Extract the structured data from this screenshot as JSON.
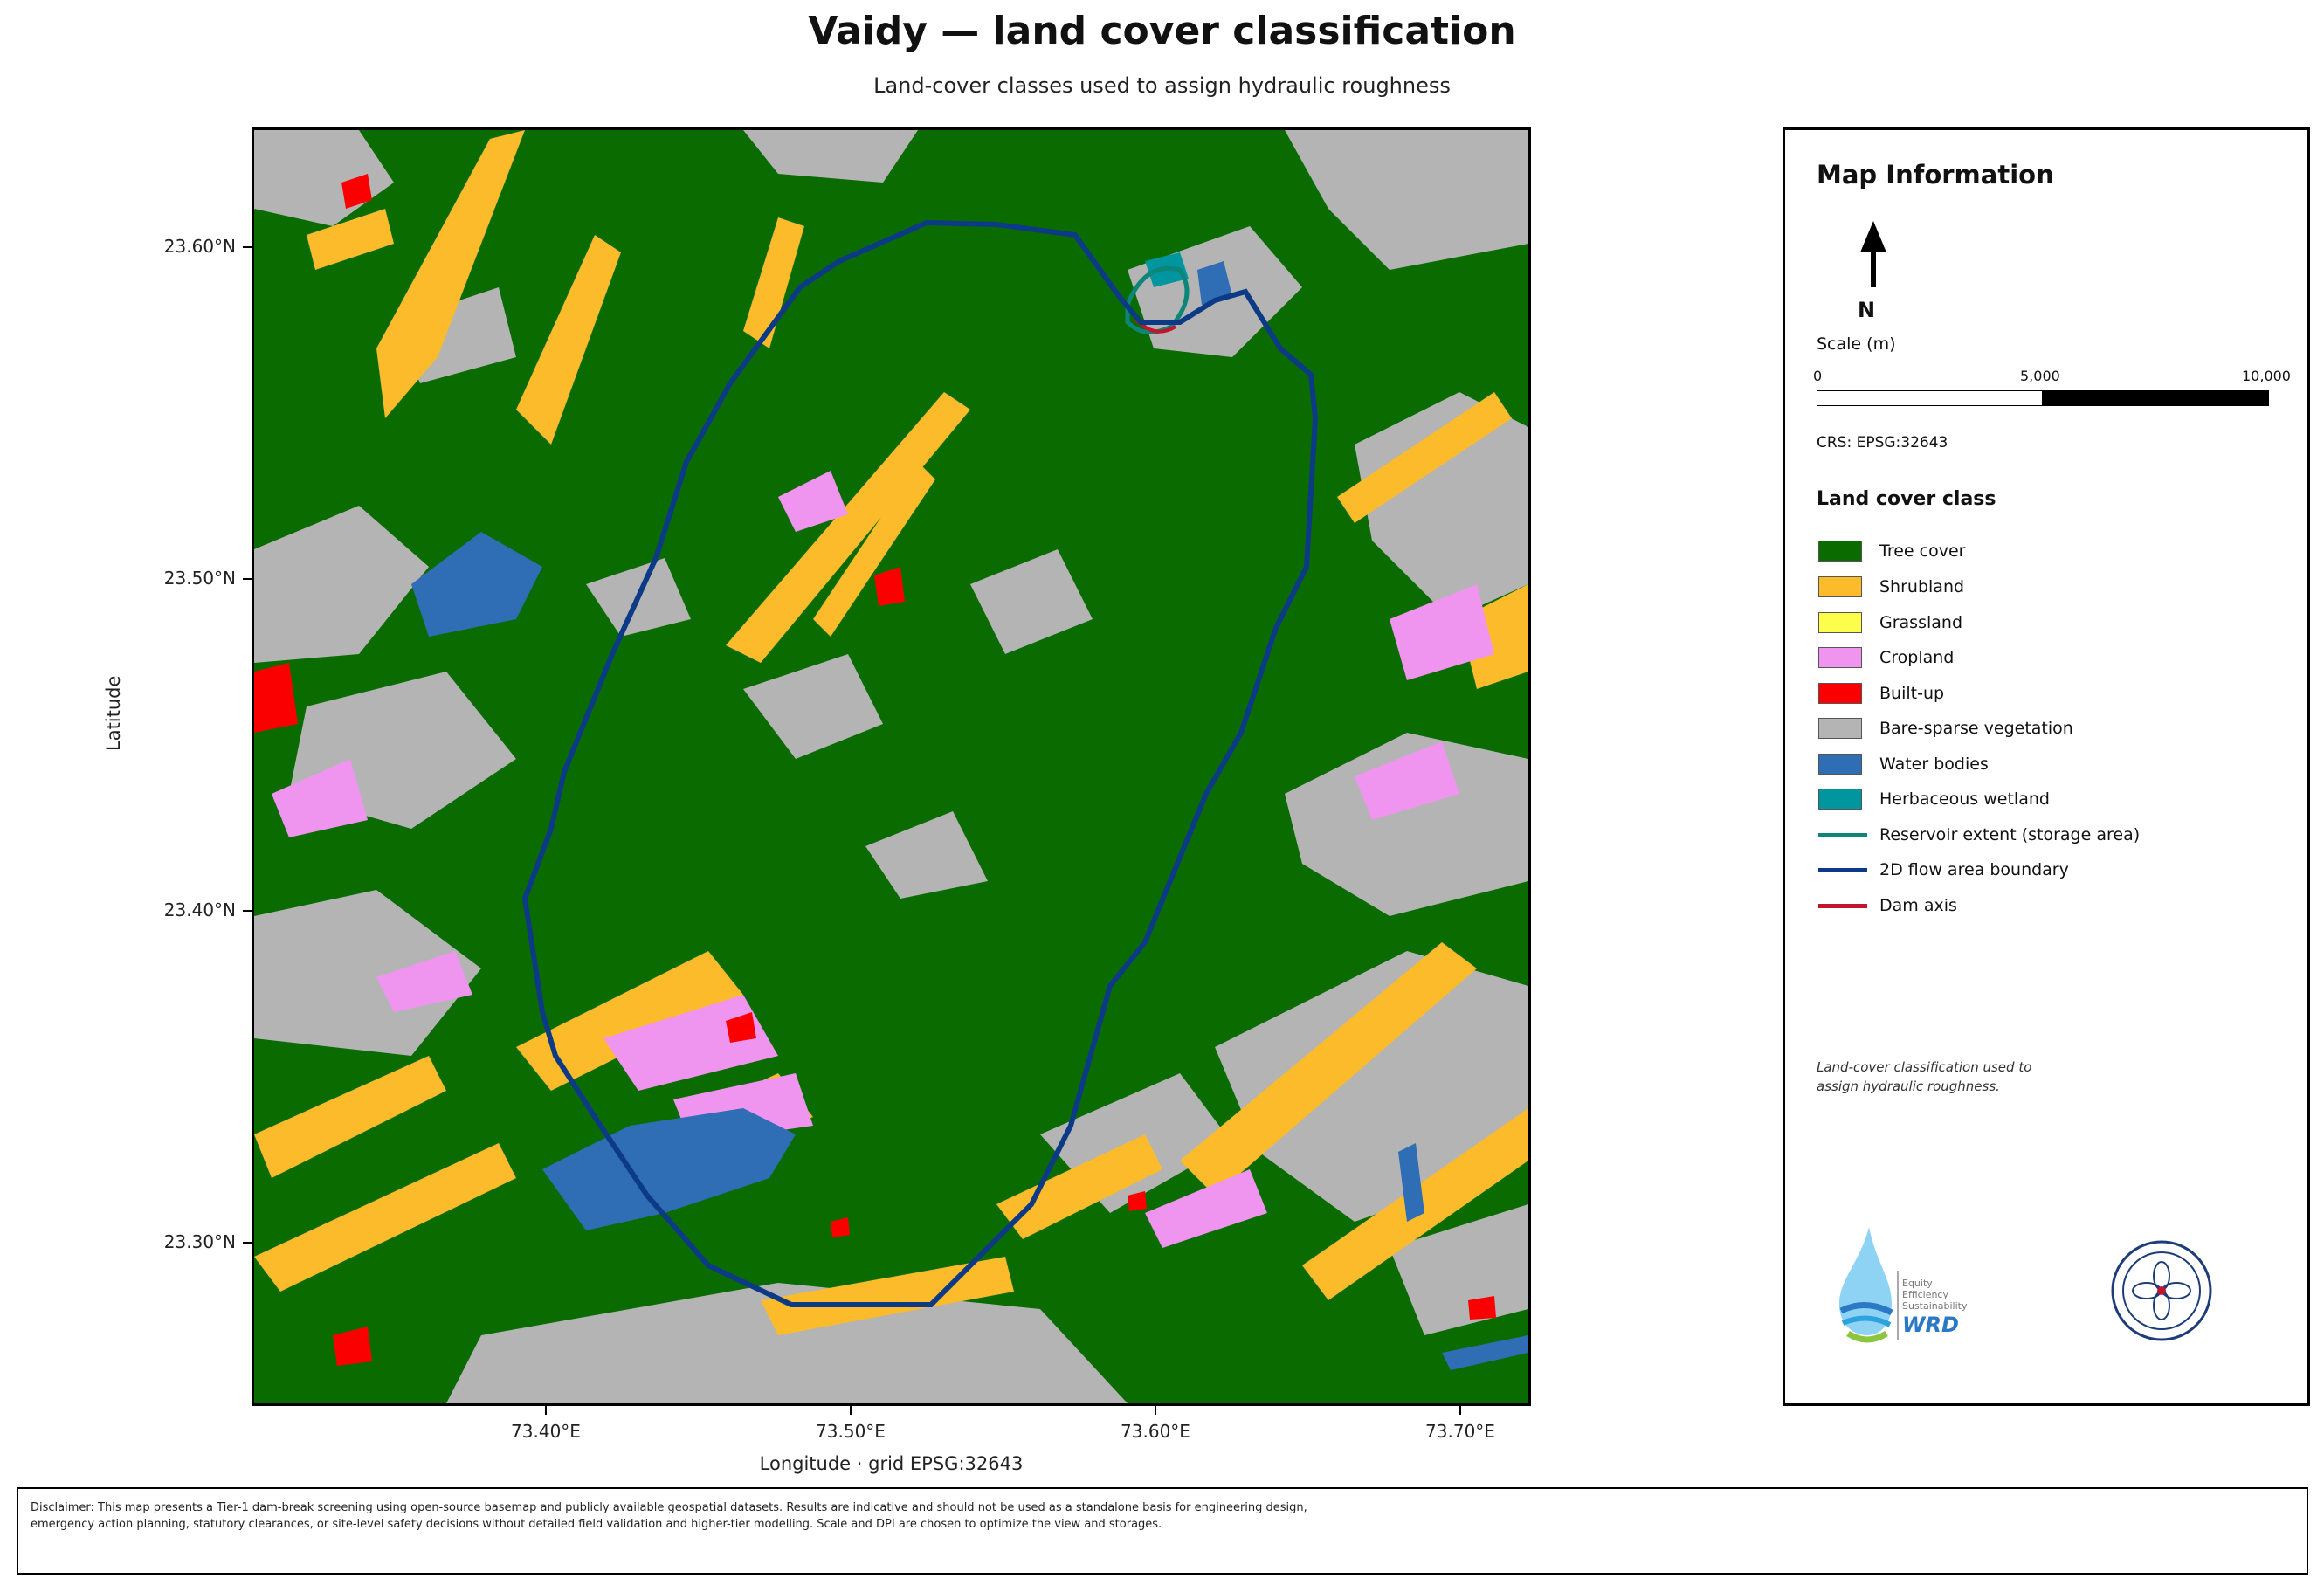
{
  "title": "Vaidy — land cover classification",
  "subtitle": "Land-cover classes used to assign hydraulic roughness",
  "map": {
    "y_ticks": [
      "23.60°N",
      "23.50°N",
      "23.40°N",
      "23.30°N"
    ],
    "x_ticks": [
      "73.40°E",
      "73.50°E",
      "73.60°E",
      "73.70°E"
    ],
    "y_axis_label": "Latitude",
    "x_axis_label": "Longitude   ·   grid EPSG:32643"
  },
  "info": {
    "heading": "Map Information",
    "north_label": "N",
    "scale_title": "Scale (m)",
    "scale_ticks": [
      "0",
      "5,000",
      "10,000"
    ],
    "crs": "CRS: EPSG:32643",
    "legend_title": "Land cover class",
    "legend": [
      {
        "label": "Tree cover",
        "color": "#0a6b00",
        "kind": "patch"
      },
      {
        "label": "Shrubland",
        "color": "#fbbb2b",
        "kind": "patch"
      },
      {
        "label": "Grassland",
        "color": "#fdfd4b",
        "kind": "patch"
      },
      {
        "label": "Cropland",
        "color": "#ef95f0",
        "kind": "patch"
      },
      {
        "label": "Built-up",
        "color": "#fb0000",
        "kind": "patch"
      },
      {
        "label": "Bare-sparse vegetation",
        "color": "#b4b4b4",
        "kind": "patch"
      },
      {
        "label": "Water bodies",
        "color": "#2f6db5",
        "kind": "patch"
      },
      {
        "label": "Herbaceous wetland",
        "color": "#00969f",
        "kind": "patch"
      },
      {
        "label": "Reservoir extent (storage area)",
        "color": "#0e857a",
        "kind": "line"
      },
      {
        "label": "2D flow area boundary",
        "color": "#0d3a86",
        "kind": "line"
      },
      {
        "label": "Dam axis",
        "color": "#c2142c",
        "kind": "line"
      }
    ],
    "note_line1": "Land-cover classification used to",
    "note_line2": "assign hydraulic roughness.",
    "logo_left_text1": "Equity",
    "logo_left_text2": "Efficiency",
    "logo_left_text3": "Sustainability",
    "logo_left_brand": "WRD"
  },
  "disclaimer": "Disclaimer: This map presents a Tier-1 dam-break screening using open-source basemap and publicly available geospatial datasets. Results are indicative and should not be used as a standalone basis for engineering design, emergency action planning, statutory clearances, or site-level safety decisions without detailed field validation and higher-tier modelling. Scale and DPI are chosen to optimize the view and storages."
}
